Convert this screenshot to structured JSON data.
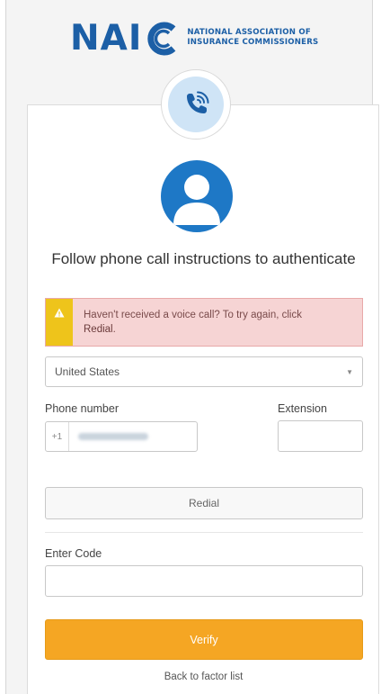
{
  "brand": {
    "logo_letters": "NAI",
    "line1": "NATIONAL ASSOCIATION OF",
    "line2": "INSURANCE COMMISSIONERS",
    "color": "#1c5fa6"
  },
  "factor": {
    "icon": "phone-call-icon",
    "avatar_icon": "user-avatar-icon",
    "accent": "#1e78c6"
  },
  "title": "Follow phone call instructions to authenticate",
  "alert": {
    "icon": "warning-icon",
    "text": "Haven't received a voice call? To try again, click",
    "emphasis": "Redial",
    "suffix": ".",
    "background": "#f6d4d4",
    "flag_color": "#eec41b"
  },
  "country_select": {
    "value": "United States"
  },
  "phone": {
    "label": "Phone number",
    "prefix": "+1",
    "extension_label": "Extension",
    "extension_value": ""
  },
  "redial_button": {
    "label": "Redial"
  },
  "code": {
    "label": "Enter Code",
    "value": ""
  },
  "verify_button": {
    "label": "Verify",
    "color": "#f5a623"
  },
  "back_link": {
    "label": "Back to factor list"
  }
}
